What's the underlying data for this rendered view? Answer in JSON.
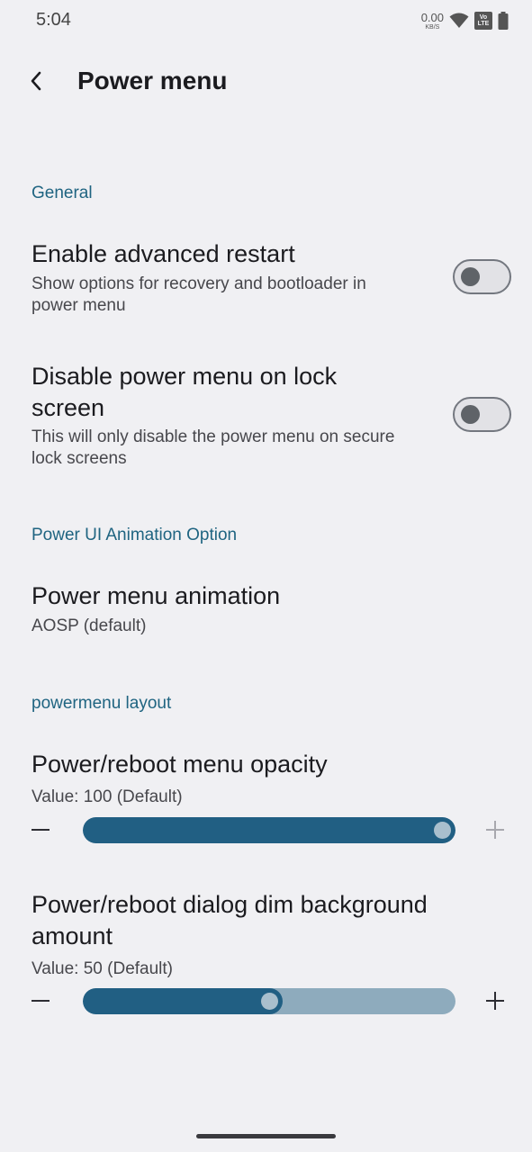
{
  "status_bar": {
    "time": "5:04",
    "net_speed_value": "0.00",
    "net_speed_unit": "KB/S",
    "volte_top": "Vo",
    "volte_bottom": "LTE",
    "icons": [
      "wifi-icon",
      "volte-icon",
      "battery-icon"
    ]
  },
  "app_bar": {
    "title": "Power menu",
    "back_icon": "arrow-back-icon"
  },
  "colors": {
    "accent": "#1f6481",
    "slider_active": "#215f83",
    "slider_inactive": "#8eabbd",
    "background": "#f0f0f3"
  },
  "sections": {
    "general": {
      "header": "General",
      "advanced_restart": {
        "title": "Enable advanced restart",
        "summary_line1": "Show options for recovery and bootloader in",
        "summary_line2": "power menu",
        "enabled": false
      },
      "disable_lock": {
        "title_line1": "Disable power menu on lock",
        "title_line2": "screen",
        "summary_line1": "This will only disable the power menu on secure",
        "summary_line2": "lock screens",
        "enabled": false
      }
    },
    "animation": {
      "header": "Power UI Animation Option",
      "item": {
        "title": "Power menu animation",
        "summary": "AOSP (default)"
      }
    },
    "layout": {
      "header": "powermenu layout",
      "opacity": {
        "title": "Power/reboot menu opacity",
        "value_text": "Value: 100 (Default)",
        "value": 100,
        "max": 100
      },
      "dim": {
        "title_line1": "Power/reboot dialog dim background",
        "title_line2": "amount",
        "value_text": "Value: 50 (Default)",
        "value": 50,
        "max": 100
      }
    }
  }
}
